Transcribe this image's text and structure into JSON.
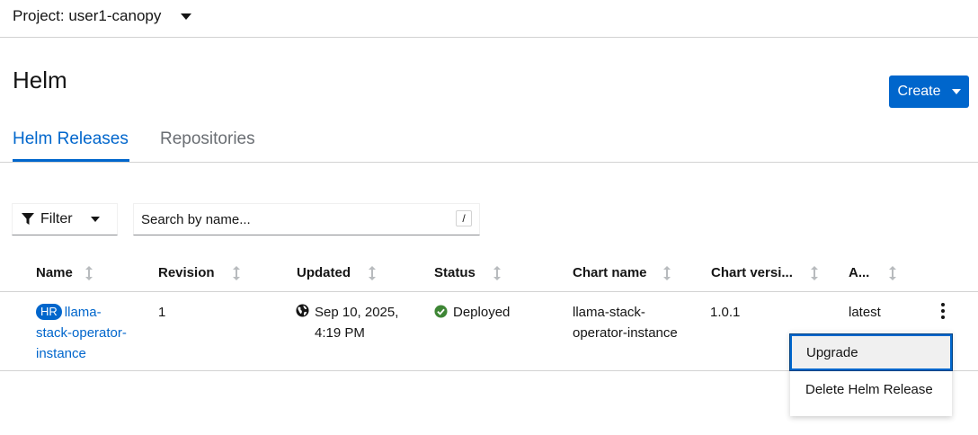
{
  "project": {
    "label": "Project: user1-canopy"
  },
  "page": {
    "title": "Helm"
  },
  "create_button": {
    "label": "Create"
  },
  "tabs": [
    {
      "label": "Helm Releases",
      "active": true
    },
    {
      "label": "Repositories",
      "active": false
    }
  ],
  "toolbar": {
    "filter_label": "Filter",
    "search_placeholder": "Search by name...",
    "search_value": "",
    "search_shortcut": "/"
  },
  "table": {
    "columns": [
      "Name",
      "Revision",
      "Updated",
      "Status",
      "Chart name",
      "Chart versi...",
      "A..."
    ],
    "rows": [
      {
        "badge": "HR",
        "name_lines": [
          "llama-",
          "stack-operator-",
          "instance"
        ],
        "revision": "1",
        "updated_lines": [
          "Sep 10, 2025,",
          "4:19 PM"
        ],
        "status": "Deployed",
        "chart_name_lines": [
          "llama-stack-",
          "operator-instance"
        ],
        "chart_version": "1.0.1",
        "app_version": "latest"
      }
    ]
  },
  "row_menu": {
    "items": [
      {
        "label": "Upgrade",
        "focused": true
      },
      {
        "label": "Delete Helm Release",
        "focused": false
      }
    ]
  },
  "colors": {
    "accent": "#0066cc",
    "success": "#3e8635",
    "text": "#151515",
    "muted": "#6a6e73"
  },
  "icons": [
    "caret-down-icon",
    "filter-icon",
    "sort-icon",
    "globe-icon",
    "check-circle-icon",
    "kebab-icon"
  ]
}
